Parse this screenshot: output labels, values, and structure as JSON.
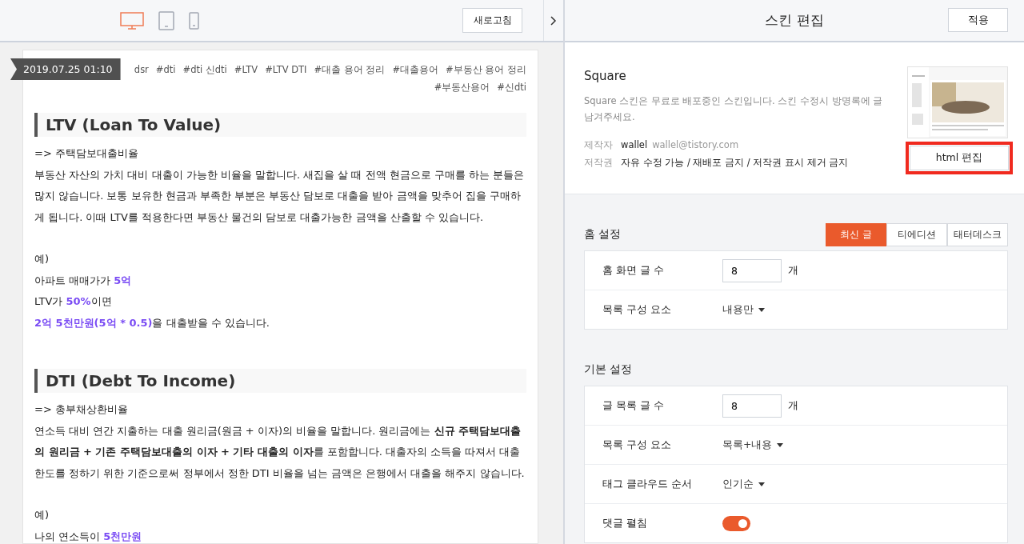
{
  "preview": {
    "devices": [
      {
        "kind": "desktop",
        "selected": true
      },
      {
        "kind": "tablet",
        "selected": false
      },
      {
        "kind": "mobile",
        "selected": false
      }
    ],
    "refresh_button": "새로고침",
    "post": {
      "date": "2019.07.25 01:10",
      "tags": [
        "dsr",
        "#dti",
        "#dti 신dti",
        "#LTV",
        "#LTV DTI",
        "#대출 용어 정리",
        "#대출용어",
        "#부동산 용어 정리",
        "#부동산용어",
        "#신dti"
      ],
      "blocks": [
        {
          "kind": "heading",
          "text": "LTV (Loan To Value)"
        },
        {
          "kind": "line",
          "text": "=> 주택담보대출비율"
        },
        {
          "kind": "para",
          "text": "부동산 자산의 가치 대비 대출이 가능한 비율을 말합니다. 새집을 살 때 전액 현금으로 구매를 하는 분들은 많지 않습니다. 보통 보유한 현금과 부족한 부분은 부동산 담보로 대출을 받아 금액을 맞추어 집을 구매하게 됩니다. 이때 LTV를 적용한다면 부동산 물건의 담보로 대출가능한 금액을 산출할 수 있습니다."
        },
        {
          "kind": "label",
          "text": "예)"
        },
        {
          "kind": "example",
          "text": "아파트 매매가가 **5억**"
        },
        {
          "kind": "example",
          "text": "LTV가 **50%**이면"
        },
        {
          "kind": "example",
          "text": "**2억 5천만원(5억 * 0.5)**을 대출받을 수 있습니다."
        },
        {
          "kind": "heading",
          "text": "DTI (Debt To Income)"
        },
        {
          "kind": "line",
          "text": "=> 총부채상환비율"
        },
        {
          "kind": "para",
          "text": "연소득 대비 연간 지출하는 대출 원리금(원금 + 이자)의 비율을 말합니다. 원리금에는 **신규 주택담보대출의 원리금 + 기존 주택담보대출의 이자 + 기타 대출의 이자**를 포함합니다. 대출자의 소득을 따져서 대출 한도를 정하기 위한 기준으로써 정부에서 정한 DTI 비율을 넘는 금액은 은행에서 대출을 해주지 않습니다."
        },
        {
          "kind": "label",
          "text": "예)"
        },
        {
          "kind": "example",
          "text": "나의 연소득이 **5천만원**"
        }
      ]
    }
  },
  "editor": {
    "title": "스킨 편집",
    "apply_button": "적용",
    "skin": {
      "name": "Square",
      "description": "Square 스킨은 무료로 배포중인 스킨입니다. 스킨 수정시 방명록에 글 남겨주세요.",
      "meta": [
        {
          "label": "제작자",
          "value": "wallel",
          "extra": "wallel@tistory.com"
        },
        {
          "label": "저작권",
          "value": "자유 수정 가능 / 재배포 금지 / 저작권 표시 제거 금지"
        }
      ],
      "html_button": {
        "label": "html 편집",
        "highlighted": true
      }
    },
    "sections": [
      {
        "title": "홈 설정",
        "tabs": [
          {
            "label": "최신 글",
            "selected": true
          },
          {
            "label": "티에디션",
            "selected": false
          },
          {
            "label": "태터데스크",
            "selected": false
          }
        ],
        "rows": [
          {
            "kind": "number",
            "label": "홈 화면 글 수",
            "value": "8",
            "unit": "개"
          },
          {
            "kind": "select",
            "label": "목록 구성 요소",
            "value": "내용만"
          }
        ]
      },
      {
        "title": "기본 설정",
        "rows": [
          {
            "kind": "number",
            "label": "글 목록 글 수",
            "value": "8",
            "unit": "개"
          },
          {
            "kind": "select",
            "label": "목록 구성 요소",
            "value": "목록+내용"
          },
          {
            "kind": "select",
            "label": "태그 클라우드 순서",
            "value": "인기순"
          },
          {
            "kind": "toggle",
            "label": "댓글 펼침",
            "on": true
          }
        ]
      }
    ]
  }
}
